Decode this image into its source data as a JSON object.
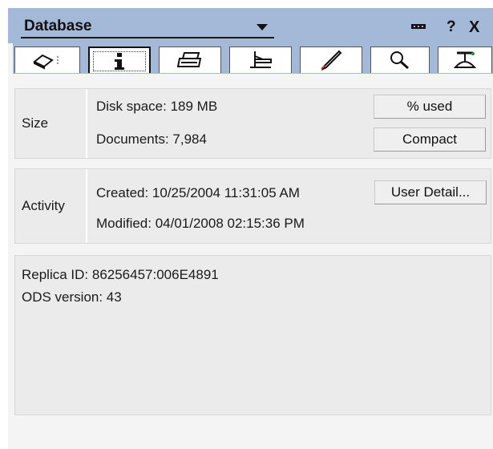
{
  "title": "Database",
  "titlebar_icons": [
    "pin-icon",
    "help-icon",
    "close-icon"
  ],
  "titlebar_glyphs": {
    "help": "?",
    "close": "X"
  },
  "tabs": [
    {
      "name": "tab-basics",
      "icon": "eraser-icon"
    },
    {
      "name": "tab-info",
      "icon": "info-icon",
      "active": true
    },
    {
      "name": "tab-printing",
      "icon": "printer-icon"
    },
    {
      "name": "tab-design",
      "icon": "drafting-icon"
    },
    {
      "name": "tab-launch",
      "icon": "rocket-icon"
    },
    {
      "name": "tab-full-text",
      "icon": "magnifier-icon"
    },
    {
      "name": "tab-advanced",
      "icon": "propeller-hat-icon"
    }
  ],
  "size": {
    "label": "Size",
    "disk_space": "Disk space:  189 MB",
    "documents": "Documents: 7,984",
    "percent_used_button": "% used",
    "compact_button": "Compact"
  },
  "activity": {
    "label": "Activity",
    "created": "Created:  10/25/2004 11:31:05 AM",
    "modified": "Modified: 04/01/2008 02:15:36 PM",
    "user_detail_button": "User Detail..."
  },
  "info": {
    "replica_id": "Replica ID:    86256457:006E4891",
    "ods_version": "ODS version: 43"
  },
  "colors": {
    "titlebar": "#a4b8d8",
    "panel": "#ebebeb",
    "background": "#f4f4f4"
  }
}
